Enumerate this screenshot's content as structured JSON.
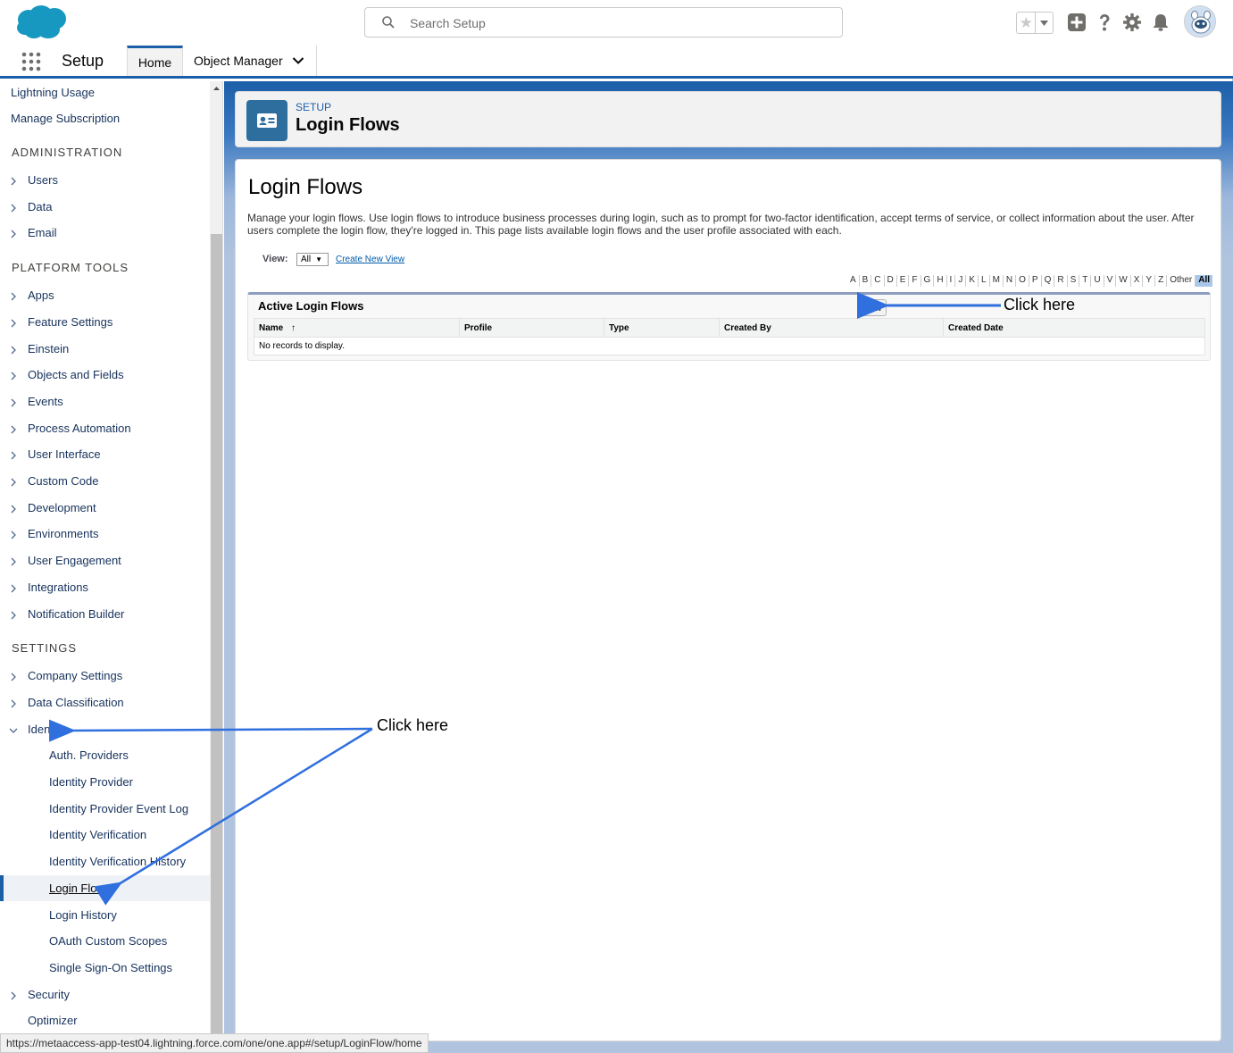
{
  "header": {
    "search_placeholder": "Search Setup"
  },
  "context_bar": {
    "app_name": "Setup",
    "tabs": [
      {
        "label": "Home"
      },
      {
        "label": "Object Manager"
      }
    ]
  },
  "sidebar": {
    "top_items": [
      "Lightning Usage",
      "Manage Subscription"
    ],
    "sections": {
      "administration": "ADMINISTRATION",
      "platform_tools": "PLATFORM TOOLS",
      "settings": "SETTINGS"
    },
    "administration_items": [
      "Users",
      "Data",
      "Email"
    ],
    "platform_items": [
      "Apps",
      "Feature Settings",
      "Einstein",
      "Objects and Fields",
      "Events",
      "Process Automation",
      "User Interface",
      "Custom Code",
      "Development",
      "Environments",
      "User Engagement",
      "Integrations",
      "Notification Builder"
    ],
    "settings_items": [
      "Company Settings",
      "Data Classification",
      "Identity"
    ],
    "identity_children": [
      "Auth. Providers",
      "Identity Provider",
      "Identity Provider Event Log",
      "Identity Verification",
      "Identity Verification History",
      "Login Flows",
      "Login History",
      "OAuth Custom Scopes",
      "Single Sign-On Settings"
    ],
    "bottom_items": [
      "Security",
      "Optimizer"
    ]
  },
  "page_header": {
    "eyebrow": "SETUP",
    "title": "Login Flows"
  },
  "content": {
    "title": "Login Flows",
    "description": "Manage your login flows. Use login flows to introduce business processes during login, such as to prompt for two-factor identification, accept terms of service, or collect information about the user. After users complete the login flow, they're logged in. This page lists available login flows and the user profile associated with each.",
    "view_label": "View:",
    "view_value": "All",
    "create_view": "Create New View",
    "alphabet": [
      "A",
      "B",
      "C",
      "D",
      "E",
      "F",
      "G",
      "H",
      "I",
      "J",
      "K",
      "L",
      "M",
      "N",
      "O",
      "P",
      "Q",
      "R",
      "S",
      "T",
      "U",
      "V",
      "W",
      "X",
      "Y",
      "Z",
      "Other",
      "All"
    ],
    "alphabet_selected": "All",
    "list": {
      "title": "Active Login Flows",
      "new_button": "New",
      "columns": [
        "Name",
        "Profile",
        "Type",
        "Created By",
        "Created Date"
      ],
      "sort_indicator": "↑",
      "empty": "No records to display."
    }
  },
  "annotations": {
    "click_here_top": "Click here",
    "click_here_bottom": "Click here",
    "arrow_color": "#2f6fde"
  },
  "status_bar": {
    "url": "https://metaaccess-app-test04.lightning.force.com/one/one.app#/setup/LoginFlow/home"
  },
  "colors": {
    "brand_blue": "#1b5fa8",
    "cloud_blue": "#1798c1",
    "link_text": "#16325c"
  }
}
